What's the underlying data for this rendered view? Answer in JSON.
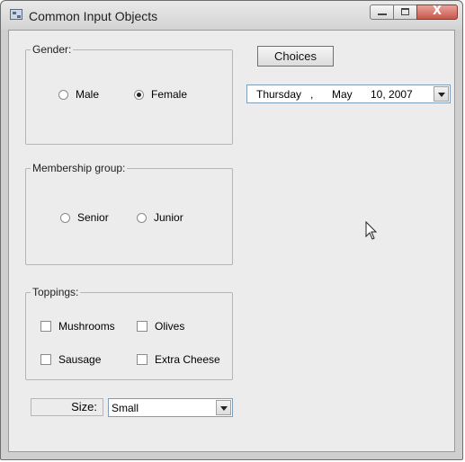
{
  "window": {
    "title": "Common Input Objects",
    "controls": {
      "minimize": "—",
      "maximize": "□",
      "close": "X"
    }
  },
  "gender": {
    "legend": "Gender:",
    "options": [
      {
        "label": "Male",
        "checked": false
      },
      {
        "label": "Female",
        "checked": true
      }
    ]
  },
  "membership": {
    "legend": "Membership group:",
    "options": [
      {
        "label": "Senior",
        "checked": false
      },
      {
        "label": "Junior",
        "checked": false
      }
    ]
  },
  "toppings": {
    "legend": "Toppings:",
    "items": [
      {
        "label": "Mushrooms",
        "checked": false
      },
      {
        "label": "Olives",
        "checked": false
      },
      {
        "label": "Sausage",
        "checked": false
      },
      {
        "label": "Extra Cheese",
        "checked": false
      }
    ]
  },
  "size": {
    "label": "Size:",
    "selected": "Small"
  },
  "choices_button": {
    "label": "Choices"
  },
  "date_picker": {
    "day": "Thursday",
    "sep": ",",
    "month": "May",
    "date": "10, 2007"
  },
  "icons": [
    "app-icon",
    "minimize-icon",
    "maximize-icon",
    "close-icon",
    "chevron-down-icon",
    "mouse-cursor-icon"
  ]
}
